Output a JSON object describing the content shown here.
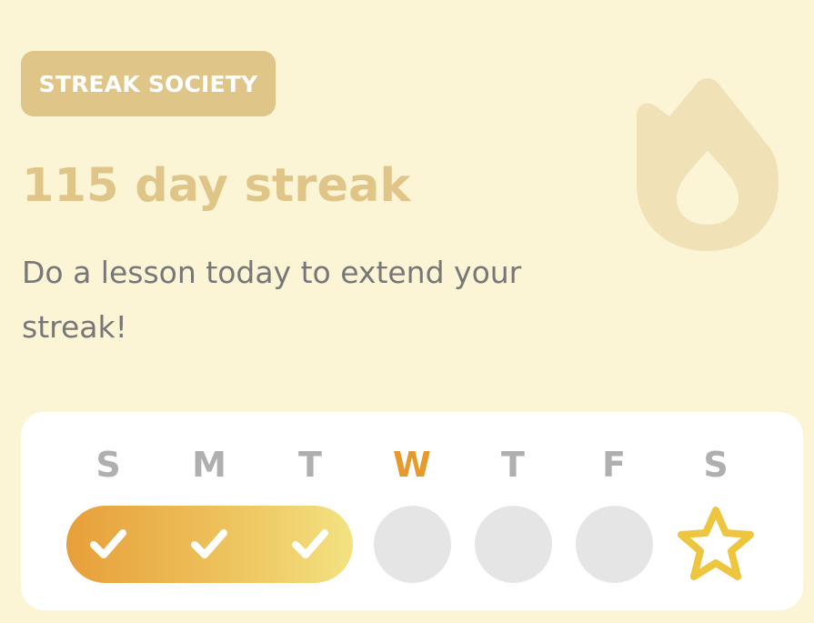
{
  "badge": {
    "label": "STREAK SOCIETY"
  },
  "streak": {
    "title": "115 day streak",
    "subtitle": "Do a lesson today to extend your streak!"
  },
  "week": {
    "days": [
      {
        "letter": "S",
        "status": "completed"
      },
      {
        "letter": "M",
        "status": "completed"
      },
      {
        "letter": "T",
        "status": "completed"
      },
      {
        "letter": "W",
        "status": "today"
      },
      {
        "letter": "T",
        "status": "upcoming"
      },
      {
        "letter": "F",
        "status": "upcoming"
      },
      {
        "letter": "S",
        "status": "goal-star"
      }
    ]
  },
  "colors": {
    "background": "#FBF5D6",
    "badge": "#E0C589",
    "title": "#E0C588",
    "flame": "#F0E2B6",
    "today_label": "#E59A2E",
    "day_label": "#AFAFAF",
    "pill_start": "#E79F3A",
    "pill_end": "#F3E281",
    "empty_day": "#E5E5E5",
    "star": "#EDC53E"
  },
  "icons": {
    "flame": "flame-icon",
    "check": "checkmark-icon",
    "star": "star-icon"
  }
}
